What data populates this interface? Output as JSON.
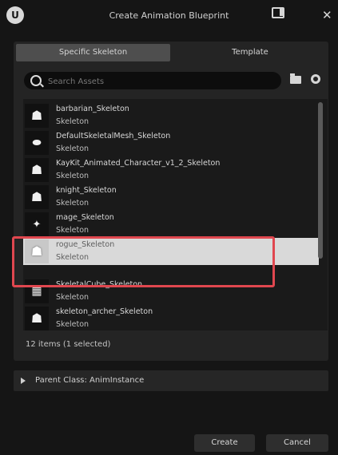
{
  "window": {
    "title": "Create Animation Blueprint"
  },
  "tabs": [
    {
      "label": "Specific Skeleton",
      "active": true
    },
    {
      "label": "Template",
      "active": false
    }
  ],
  "search": {
    "placeholder": "Search Assets"
  },
  "assets": [
    {
      "name": "barbarian_Skeleton",
      "type": "Skeleton"
    },
    {
      "name": "DefaultSkeletalMesh_Skeleton",
      "type": "Skeleton"
    },
    {
      "name": "KayKit_Animated_Character_v1_2_Skeleton",
      "type": "Skeleton"
    },
    {
      "name": "knight_Skeleton",
      "type": "Skeleton"
    },
    {
      "name": "mage_Skeleton",
      "type": "Skeleton"
    },
    {
      "name": "rogue_Skeleton",
      "type": "Skeleton",
      "selected": true
    },
    {
      "name": "SkeletalCube_Skeleton",
      "type": "Skeleton"
    },
    {
      "name": "skeleton_archer_Skeleton",
      "type": "Skeleton"
    }
  ],
  "status_text": "12 items (1 selected)",
  "parent_class": {
    "label": "Parent Class: AnimInstance"
  },
  "buttons": {
    "create": "Create",
    "cancel": "Cancel"
  },
  "colors": {
    "highlight": "#e0474f",
    "selection": "#d9d9d9"
  }
}
